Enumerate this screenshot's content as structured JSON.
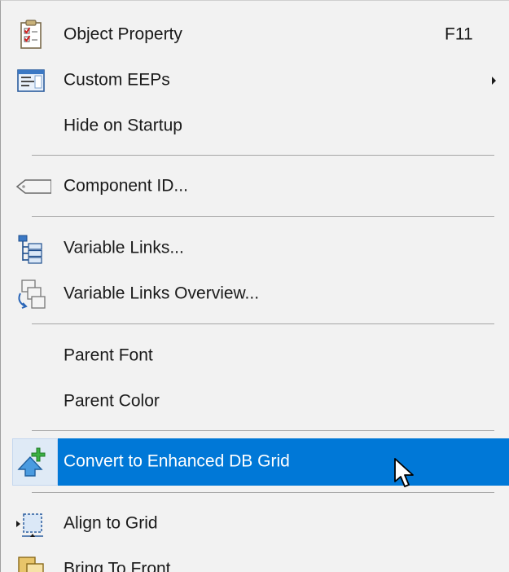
{
  "menu": {
    "items": [
      {
        "label": "Object Property",
        "shortcut": "F11",
        "icon": "object-property-icon"
      },
      {
        "label": "Custom EEPs",
        "submenu": true,
        "icon": "custom-eeps-icon"
      },
      {
        "label": "Hide on Startup"
      },
      {
        "label": "Component ID...",
        "icon": "component-id-tag-icon"
      },
      {
        "label": "Variable Links...",
        "icon": "variable-links-tree-icon"
      },
      {
        "label": "Variable Links Overview...",
        "icon": "variable-links-overview-icon"
      },
      {
        "label": "Parent Font"
      },
      {
        "label": "Parent Color"
      },
      {
        "label": "Convert to Enhanced DB Grid",
        "icon": "convert-arrow-plus-icon",
        "highlighted": true
      },
      {
        "label": "Align to Grid",
        "icon": "align-to-grid-icon"
      },
      {
        "label": "Bring To Front",
        "icon": "bring-to-front-icon"
      }
    ]
  },
  "colors": {
    "menu_background": "#f2f2f2",
    "highlight": "#0078d7",
    "separator": "#a6a6a6",
    "text": "#1a1a1a"
  },
  "cursor": "mouse-pointer-icon"
}
